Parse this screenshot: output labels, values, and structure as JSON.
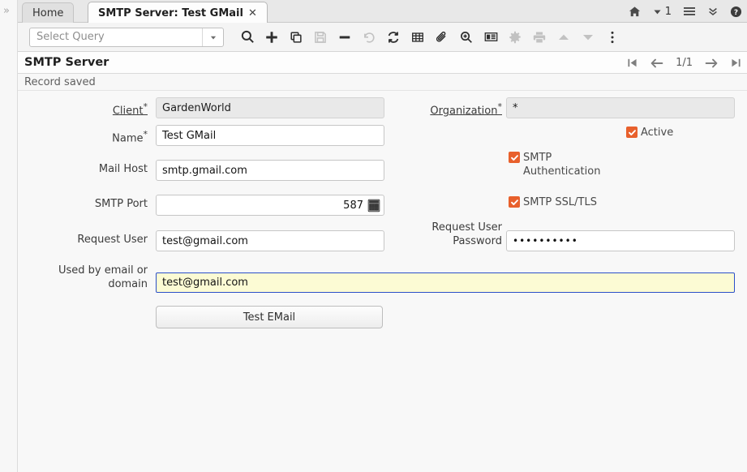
{
  "window": {
    "rail_expand_icon": "chevron-double-right-icon"
  },
  "tabs": [
    {
      "label": "Home",
      "active": false
    },
    {
      "label": "SMTP Server: Test GMail",
      "active": true,
      "close": "✕"
    }
  ],
  "top_icons": [
    {
      "name": "home-icon",
      "label": ""
    },
    {
      "name": "notifications-dropdown-icon",
      "label": "1"
    },
    {
      "name": "menu-icon",
      "label": ""
    },
    {
      "name": "chevron-double-down-icon",
      "label": ""
    },
    {
      "name": "help-icon",
      "label": ""
    }
  ],
  "toolbar": {
    "query": {
      "value": "Select Query",
      "placeholder": "Select Query"
    },
    "buttons": [
      {
        "name": "search-icon",
        "label": "Search",
        "enabled": true
      },
      {
        "name": "new-record-icon",
        "label": "New Record",
        "enabled": true
      },
      {
        "name": "copy-record-icon",
        "label": "Copy Record",
        "enabled": true
      },
      {
        "name": "save-icon",
        "label": "Save Changes",
        "enabled": false
      },
      {
        "name": "delete-icon",
        "label": "Delete Record",
        "enabled": true
      },
      {
        "name": "undo-icon",
        "label": "Undo Changes",
        "enabled": false
      },
      {
        "name": "refresh-icon",
        "label": "Refresh",
        "enabled": true
      },
      {
        "name": "grid-toggle-icon",
        "label": "Grid Toggle",
        "enabled": true
      },
      {
        "name": "attachment-icon",
        "label": "Attachment",
        "enabled": true
      },
      {
        "name": "zoom-icon",
        "label": "Zoom",
        "enabled": true
      },
      {
        "name": "report-icon",
        "label": "Report",
        "enabled": true
      },
      {
        "name": "gear-icon",
        "label": "Preference",
        "enabled": false
      },
      {
        "name": "print-icon",
        "label": "Print",
        "enabled": false
      },
      {
        "name": "parent-record-icon",
        "label": "Parent Record",
        "enabled": false
      },
      {
        "name": "detail-record-icon",
        "label": "Detail Record",
        "enabled": false
      },
      {
        "name": "more-menu-icon",
        "label": "More",
        "enabled": true
      }
    ]
  },
  "header": {
    "title": "SMTP Server",
    "nav": {
      "first": "first-record-icon",
      "prev": "previous-record-icon",
      "count": "1/1",
      "next": "next-record-icon",
      "last": "last-record-icon"
    }
  },
  "status": {
    "message": "Record saved"
  },
  "form": {
    "client": {
      "label": "Client",
      "required": "*",
      "value": "GardenWorld"
    },
    "name": {
      "label": "Name",
      "required": "*",
      "value": "Test GMail"
    },
    "mail_host": {
      "label": "Mail Host",
      "value": "smtp.gmail.com"
    },
    "smtp_port": {
      "label": "SMTP Port",
      "value": "587",
      "calc_icon": "calculator-icon"
    },
    "request_user": {
      "label": "Request User",
      "value": "test@gmail.com"
    },
    "used_by_email": {
      "label": "Used by email or domain",
      "value": "test@gmail.com"
    },
    "organization": {
      "label": "Organization",
      "required": "*",
      "value": "*"
    },
    "active": {
      "label": "Active",
      "checked": true
    },
    "smtp_authentication": {
      "label": "SMTP Authentication",
      "checked": true
    },
    "smtp_ssl_tls": {
      "label": "SMTP SSL/TLS",
      "checked": true
    },
    "request_user_password": {
      "label": "Request User Password",
      "value": "••••••••••"
    },
    "test_email_button": {
      "label": "Test EMail"
    }
  },
  "colors": {
    "accent_checkbox": "#e8602c",
    "focus_border": "#2b4fc8",
    "focus_background": "#fcfbd4",
    "canvas": "#f8f8f8"
  }
}
